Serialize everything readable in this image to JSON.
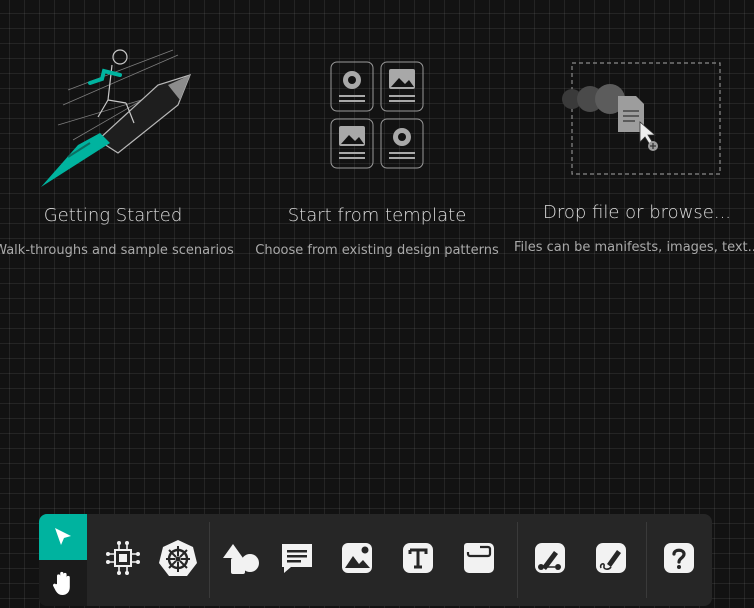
{
  "cards": {
    "getting_started": {
      "title": "Getting Started",
      "subtitle": "Walk-throughs and sample scenarios"
    },
    "template": {
      "title": "Start from template",
      "subtitle": "Choose from existing design patterns"
    },
    "drop": {
      "title": "Drop file or browse...",
      "subtitle": "Files can be manifests, images, text..."
    }
  },
  "toolbar": {
    "modes": [
      {
        "icon": "pointer-icon",
        "active": true
      },
      {
        "icon": "hand-pan-icon",
        "active": false
      }
    ],
    "tools": [
      "components-chip-icon",
      "kubernetes-helm-icon",
      "shapes-icon",
      "comment-icon",
      "image-icon",
      "text-icon",
      "section-icon",
      "pen-icon",
      "freehand-draw-icon",
      "help-icon"
    ]
  },
  "colors": {
    "accent": "#00b39f",
    "background": "#121212",
    "toolbar": "#262626",
    "icon": "#f2f2f2"
  }
}
